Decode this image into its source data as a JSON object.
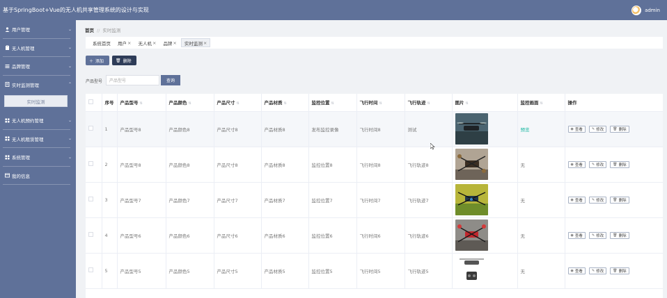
{
  "app": {
    "title": "基于SpringBoot+Vue的无人机共享管理系统的设计与实现",
    "user": "admin"
  },
  "sidebar": {
    "items": [
      {
        "label": "用户管理",
        "icon": "user-icon"
      },
      {
        "label": "无人机管理",
        "icon": "clipboard-icon"
      },
      {
        "label": "品牌管理",
        "icon": "list-icon"
      },
      {
        "label": "实时监测管理",
        "icon": "document-icon",
        "expanded": true,
        "children": [
          "实时监测"
        ]
      },
      {
        "label": "无人机预约管理",
        "icon": "grid-icon"
      },
      {
        "label": "无人机租赁管理",
        "icon": "grid-icon"
      },
      {
        "label": "系统管理",
        "icon": "grid-icon"
      },
      {
        "label": "我的信息",
        "icon": "card-icon"
      }
    ]
  },
  "breadcrumb": {
    "home": "首页",
    "sep": "//",
    "current": "实时监测"
  },
  "tabs": [
    {
      "label": "系统首页",
      "closable": false,
      "active": false
    },
    {
      "label": "用户",
      "closable": true,
      "active": false
    },
    {
      "label": "无人机",
      "closable": true,
      "active": false
    },
    {
      "label": "品牌",
      "closable": true,
      "active": false
    },
    {
      "label": "实时监测",
      "closable": true,
      "active": true
    }
  ],
  "toolbar": {
    "add_label": "添加",
    "delete_label": "删除"
  },
  "search": {
    "label": "产品型号",
    "placeholder": "产品型号",
    "button": "查询"
  },
  "table": {
    "columns": [
      "序号",
      "产品型号",
      "产品颜色",
      "产品尺寸",
      "产品材质",
      "监控位置",
      "飞行时间",
      "飞行轨迹",
      "图片",
      "监控画面",
      "操作"
    ],
    "actions": {
      "view": "查看",
      "edit": "修改",
      "delete": "删除"
    },
    "rows": [
      {
        "index": "1",
        "model": "产品型号8",
        "color": "产品颜色8",
        "size": "产品尺寸8",
        "material": "产品材质8",
        "location": "发布监控录像",
        "time": "飞行时间8",
        "track": "测试",
        "monitor": "预览"
      },
      {
        "index": "2",
        "model": "产品型号8",
        "color": "产品颜色8",
        "size": "产品尺寸8",
        "material": "产品材质8",
        "location": "监控位置8",
        "time": "飞行时间8",
        "track": "飞行轨迹8",
        "monitor": "无"
      },
      {
        "index": "3",
        "model": "产品型号7",
        "color": "产品颜色7",
        "size": "产品尺寸7",
        "material": "产品材质7",
        "location": "监控位置7",
        "time": "飞行时间7",
        "track": "飞行轨迹7",
        "monitor": "无"
      },
      {
        "index": "4",
        "model": "产品型号6",
        "color": "产品颜色6",
        "size": "产品尺寸6",
        "material": "产品材质6",
        "location": "监控位置6",
        "time": "飞行时间6",
        "track": "飞行轨迹6",
        "monitor": "无"
      },
      {
        "index": "5",
        "model": "产品型号5",
        "color": "产品颜色5",
        "size": "产品尺寸5",
        "material": "产品材质5",
        "location": "监控位置5",
        "time": "飞行时间5",
        "track": "飞行轨迹5",
        "monitor": "无"
      }
    ]
  },
  "colors": {
    "primary": "#5f7199",
    "dark": "#2e3c58",
    "teal": "#18b6a0"
  }
}
